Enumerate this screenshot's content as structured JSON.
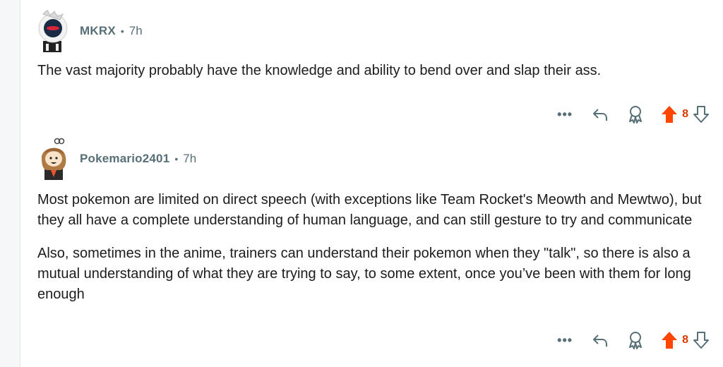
{
  "comments": [
    {
      "author": "MKRX",
      "separator": "•",
      "time": "7h",
      "body": [
        "The vast majority probably have the knowledge and ability to bend over and slap their ass."
      ],
      "actions": {
        "more_label": "•••",
        "score": "8",
        "upvoted": true
      },
      "icons": [
        "more-icon",
        "reply-icon",
        "award-icon",
        "upvote-icon",
        "downvote-icon"
      ]
    },
    {
      "author": "Pokemario2401",
      "separator": "•",
      "time": "7h",
      "body": [
        "Most pokemon are limited on direct speech (with exceptions like Team Rocket's Meowth and Mewtwo), but they all have a complete understanding of human language, and can still gesture to try and communicate",
        "Also, sometimes in the anime, trainers can understand their pokemon when they \"talk\", so there is also a mutual understanding of what they are trying to say, to some extent, once you’ve been with them for long enough"
      ],
      "actions": {
        "more_label": "•••",
        "score": "8",
        "upvoted": true
      },
      "icons": [
        "more-icon",
        "reply-icon",
        "award-icon",
        "upvote-icon",
        "downvote-icon"
      ]
    }
  ],
  "colors": {
    "upvote": "#ff4500",
    "score": "#d93a00",
    "meta": "#576f76",
    "text": "#1c1c1c"
  }
}
